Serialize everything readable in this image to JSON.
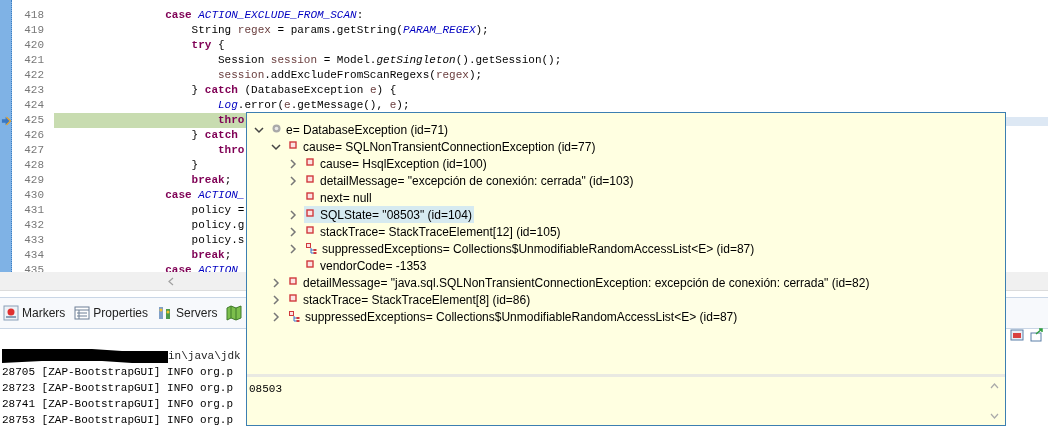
{
  "editor": {
    "lines": [
      {
        "number": "418",
        "current": false,
        "tokens": [
          {
            "text": "            case",
            "kind": "keyword"
          },
          {
            "text": " ACTION_EXCLUDE_FROM_SCAN",
            "kind": "constant"
          },
          {
            "text": ":",
            "kind": "plain"
          }
        ]
      },
      {
        "number": "419",
        "current": false,
        "tokens": [
          {
            "text": "                String ",
            "kind": "plain"
          },
          {
            "text": "regex",
            "kind": "local"
          },
          {
            "text": " = params.getString(",
            "kind": "plain"
          },
          {
            "text": "PARAM_REGEX",
            "kind": "constant"
          },
          {
            "text": ");",
            "kind": "plain"
          }
        ]
      },
      {
        "number": "420",
        "current": false,
        "tokens": [
          {
            "text": "                try",
            "kind": "keyword"
          },
          {
            "text": " {",
            "kind": "plain"
          }
        ]
      },
      {
        "number": "421",
        "current": false,
        "tokens": [
          {
            "text": "                    Session ",
            "kind": "plain"
          },
          {
            "text": "session",
            "kind": "local"
          },
          {
            "text": " = Model.",
            "kind": "plain"
          },
          {
            "text": "getSingleton",
            "kind": "static"
          },
          {
            "text": "().getSession();",
            "kind": "plain"
          }
        ]
      },
      {
        "number": "422",
        "current": false,
        "tokens": [
          {
            "text": "                    session",
            "kind": "local"
          },
          {
            "text": ".addExcludeFromScanRegexs(",
            "kind": "plain"
          },
          {
            "text": "regex",
            "kind": "local"
          },
          {
            "text": ");",
            "kind": "plain"
          }
        ]
      },
      {
        "number": "423",
        "current": false,
        "tokens": [
          {
            "text": "                } ",
            "kind": "plain"
          },
          {
            "text": "catch",
            "kind": "keyword"
          },
          {
            "text": " (DatabaseException ",
            "kind": "plain"
          },
          {
            "text": "e",
            "kind": "local"
          },
          {
            "text": ") {",
            "kind": "plain"
          }
        ]
      },
      {
        "number": "424",
        "current": false,
        "tokens": [
          {
            "text": "                    Log",
            "kind": "constant"
          },
          {
            "text": ".error(",
            "kind": "plain"
          },
          {
            "text": "e",
            "kind": "local"
          },
          {
            "text": ".getMessage(), ",
            "kind": "plain"
          },
          {
            "text": "e",
            "kind": "local"
          },
          {
            "text": ");",
            "kind": "plain"
          }
        ]
      },
      {
        "number": "425",
        "current": true,
        "tokens": [
          {
            "text": "                    thro",
            "kind": "keyword"
          }
        ]
      },
      {
        "number": "426",
        "current": false,
        "tokens": [
          {
            "text": "                } ",
            "kind": "plain"
          },
          {
            "text": "catch",
            "kind": "keyword"
          }
        ]
      },
      {
        "number": "427",
        "current": false,
        "tokens": [
          {
            "text": "                    thro",
            "kind": "keyword"
          }
        ]
      },
      {
        "number": "428",
        "current": false,
        "tokens": [
          {
            "text": "                }",
            "kind": "plain"
          }
        ]
      },
      {
        "number": "429",
        "current": false,
        "tokens": [
          {
            "text": "                break",
            "kind": "keyword"
          },
          {
            "text": ";",
            "kind": "plain"
          }
        ]
      },
      {
        "number": "430",
        "current": false,
        "tokens": [
          {
            "text": "            case",
            "kind": "keyword"
          },
          {
            "text": " ACTION_",
            "kind": "constant"
          }
        ]
      },
      {
        "number": "431",
        "current": false,
        "tokens": [
          {
            "text": "                policy =",
            "kind": "plain"
          }
        ]
      },
      {
        "number": "432",
        "current": false,
        "tokens": [
          {
            "text": "                policy.g",
            "kind": "plain"
          }
        ]
      },
      {
        "number": "433",
        "current": false,
        "tokens": [
          {
            "text": "                policy.s",
            "kind": "plain"
          }
        ]
      },
      {
        "number": "434",
        "current": false,
        "tokens": [
          {
            "text": "                break",
            "kind": "keyword"
          },
          {
            "text": ";",
            "kind": "plain"
          }
        ]
      },
      {
        "number": "435",
        "current": false,
        "tokens": [
          {
            "text": "            case",
            "kind": "keyword"
          },
          {
            "text": " ACTION",
            "kind": "constant"
          }
        ]
      }
    ]
  },
  "views": {
    "tabs": [
      {
        "label": "Markers"
      },
      {
        "label": "Properties"
      },
      {
        "label": "Servers"
      },
      {
        "kind": "icon"
      }
    ]
  },
  "console": {
    "command": "in\\java\\jdk",
    "lines": [
      "28705 [ZAP-BootstrapGUI] INFO org.p",
      "28723 [ZAP-BootstrapGUI] INFO org.p",
      "28741 [ZAP-BootstrapGUI] INFO org.p",
      "28753 [ZAP-BootstrapGUI] INFO org.p"
    ]
  },
  "inspector": {
    "tree": [
      {
        "label": "e= DatabaseException  (id=71)",
        "kind": "local",
        "expanded": true,
        "selected": false,
        "children": [
          {
            "label": "cause= SQLNonTransientConnectionException  (id=77)",
            "kind": "field",
            "expanded": true,
            "selected": false,
            "children": [
              {
                "label": "cause= HsqlException  (id=100)",
                "kind": "field",
                "expanded": false,
                "selected": false
              },
              {
                "label": "detailMessage= \"excepción de conexión: cerrada\" (id=103)",
                "kind": "field",
                "expanded": false,
                "selected": false
              },
              {
                "label": "next= null",
                "kind": "field",
                "selected": false
              },
              {
                "label": "SQLState= \"08503\" (id=104)",
                "kind": "field",
                "expanded": false,
                "selected": true
              },
              {
                "label": "stackTrace= StackTraceElement[12]  (id=105)",
                "kind": "field",
                "expanded": false,
                "selected": false
              },
              {
                "label": "suppressedExceptions= Collections$UnmodifiableRandomAccessList<E>  (id=87)",
                "kind": "collection",
                "expanded": false,
                "selected": false
              },
              {
                "label": "vendorCode= -1353",
                "kind": "field",
                "selected": false
              }
            ]
          },
          {
            "label": "detailMessage= \"java.sql.SQLNonTransientConnectionException: excepción de conexión: cerrada\" (id=82)",
            "kind": "field",
            "expanded": false,
            "selected": false
          },
          {
            "label": "stackTrace= StackTraceElement[8]  (id=86)",
            "kind": "field",
            "expanded": false,
            "selected": false
          },
          {
            "label": "suppressedExceptions= Collections$UnmodifiableRandomAccessList<E>  (id=87)",
            "kind": "collection",
            "expanded": false,
            "selected": false
          }
        ]
      }
    ],
    "detail": "08503"
  }
}
